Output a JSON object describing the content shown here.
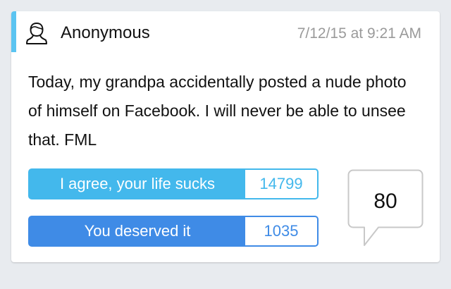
{
  "post": {
    "author": "Anonymous",
    "timestamp": "7/12/15 at 9:21 AM",
    "avatar_icon": "person-outline-icon",
    "text": "Today, my grandpa accidentally posted a nude photo of himself on Facebook. I will never be able to unsee that. FML"
  },
  "votes": {
    "agree": {
      "label": "I agree, your life sucks",
      "count": "14799"
    },
    "deserved": {
      "label": "You deserved it",
      "count": "1035"
    }
  },
  "comments": {
    "count": "80",
    "icon": "speech-bubble-icon"
  },
  "colors": {
    "accent": "#5bc4f1",
    "agree": "#43b8ec",
    "deserved": "#3f8be6",
    "timestamp": "#9a9a9a"
  }
}
